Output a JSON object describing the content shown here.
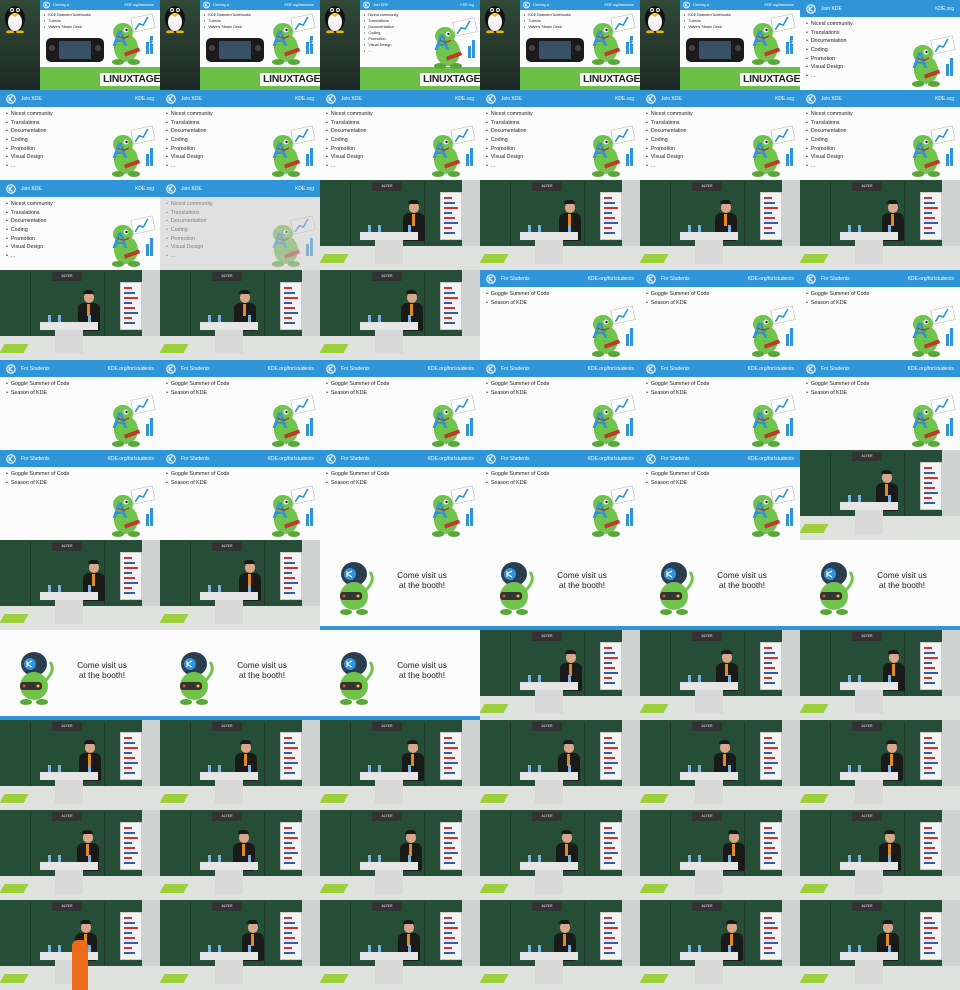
{
  "slides": {
    "gaming": {
      "title": "Gaming &",
      "url": "KDE.org/hardware",
      "bullets": [
        "KDE Branded Notebooks",
        "Tuxedo",
        "Valve's Steam Deck"
      ],
      "event_logo": "LINUXTAGE",
      "event_year": "24"
    },
    "join": {
      "title": "Join KDE",
      "url": "KDE.org",
      "bullets": [
        "Nicest community",
        "Translations",
        "Documentation",
        "Coding",
        "Promotion",
        "Visual Design",
        "..."
      ]
    },
    "students": {
      "title": "For Students",
      "url": "KDE.org/for/students",
      "bullets": [
        "Goggle Summer of Code",
        "Season of KDE"
      ]
    },
    "booth": {
      "line1": "Come visit us",
      "line2": "at the booth!"
    }
  },
  "talk_sign_text": "ALTER",
  "frames": [
    "gaming",
    "gaming",
    "join_small",
    "gaming",
    "gaming",
    "join",
    "join",
    "join",
    "join",
    "join",
    "join",
    "join",
    "join",
    "join_faded",
    "talk",
    "talk",
    "talk",
    "talk",
    "talk",
    "talk",
    "talk",
    "students",
    "students",
    "students",
    "students",
    "students",
    "students",
    "students",
    "students",
    "students",
    "students",
    "students",
    "students",
    "students",
    "students",
    "talk",
    "talk",
    "talk",
    "booth",
    "booth",
    "booth",
    "booth",
    "booth",
    "booth",
    "booth",
    "talk",
    "talk",
    "talk",
    "talk",
    "talk",
    "talk",
    "talk",
    "talk",
    "talk",
    "talk",
    "talk",
    "talk",
    "talk",
    "talk",
    "talk",
    "talk_orange",
    "talk",
    "talk",
    "talk",
    "talk",
    "talk"
  ],
  "colors": {
    "header_blue": "#2f95d8",
    "kde_green": "#5fb83e",
    "chalkboard": "#264d36"
  }
}
